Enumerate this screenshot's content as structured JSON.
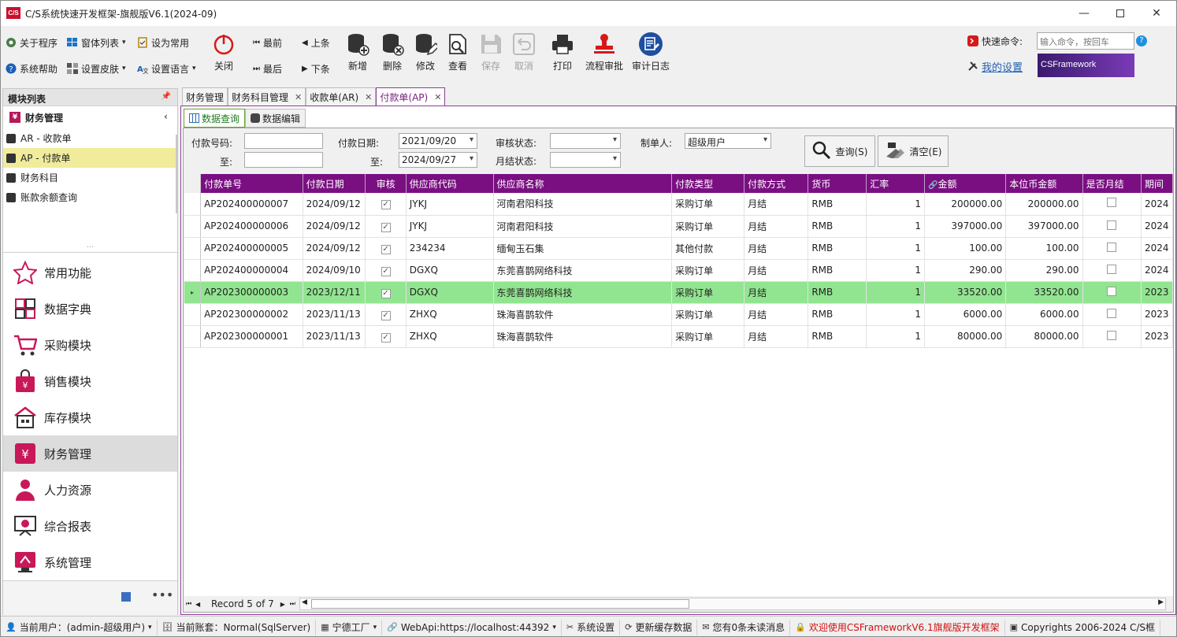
{
  "app": {
    "title": "C/S系统快速开发框架-旗舰版V6.1(2024-09)",
    "logo": "C/S"
  },
  "ribbon": {
    "left_small": [
      {
        "label": "关于程序",
        "icon": "gear-icon"
      },
      {
        "label": "窗体列表",
        "icon": "windows-icon",
        "dropdown": true
      },
      {
        "label": "设为常用",
        "icon": "clipboard-icon"
      },
      {
        "label": "系统帮助",
        "icon": "help-icon"
      },
      {
        "label": "设置皮肤",
        "icon": "skin-icon",
        "dropdown": true
      },
      {
        "label": "设置语言",
        "icon": "language-icon",
        "dropdown": true
      }
    ],
    "close_label": "关闭",
    "nav": {
      "first": "最前",
      "prev": "上条",
      "last": "最后",
      "next": "下条"
    },
    "actions": [
      {
        "label": "新增",
        "icon": "add-db-icon",
        "disabled": false
      },
      {
        "label": "删除",
        "icon": "delete-db-icon",
        "disabled": false
      },
      {
        "label": "修改",
        "icon": "edit-db-icon",
        "disabled": false
      },
      {
        "label": "查看",
        "icon": "view-doc-icon",
        "disabled": false
      },
      {
        "label": "保存",
        "icon": "save-icon",
        "disabled": true
      },
      {
        "label": "取消",
        "icon": "undo-icon",
        "disabled": true
      },
      {
        "label": "打印",
        "icon": "printer-icon",
        "disabled": false
      },
      {
        "label": "流程审批",
        "icon": "stamp-icon",
        "disabled": false
      },
      {
        "label": "审计日志",
        "icon": "audit-log-icon",
        "disabled": false
      }
    ],
    "quick_cmd_label": "快速命令:",
    "quick_cmd_placeholder": "输入命令，按回车",
    "my_settings": "我的设置",
    "brand": "CSFramework"
  },
  "left_panel": {
    "header": "模块列表",
    "group": "财务管理",
    "items": [
      {
        "label": "AR - 收款单",
        "selected": false
      },
      {
        "label": "AP - 付款单",
        "selected": true
      },
      {
        "label": "财务科目",
        "selected": false
      },
      {
        "label": "账款余额查询",
        "selected": false
      }
    ],
    "nav": [
      {
        "label": "常用功能",
        "icon": "star-icon",
        "active": false
      },
      {
        "label": "数据字典",
        "icon": "dictionary-icon",
        "active": false
      },
      {
        "label": "采购模块",
        "icon": "cart-icon",
        "active": false
      },
      {
        "label": "销售模块",
        "icon": "shopping-bag-icon",
        "active": false
      },
      {
        "label": "库存模块",
        "icon": "warehouse-icon",
        "active": false
      },
      {
        "label": "财务管理",
        "icon": "finance-icon",
        "active": true
      },
      {
        "label": "人力资源",
        "icon": "person-icon",
        "active": false
      },
      {
        "label": "综合报表",
        "icon": "report-icon",
        "active": false
      },
      {
        "label": "系统管理",
        "icon": "system-icon",
        "active": false
      }
    ]
  },
  "tabs": [
    {
      "label": "财务管理",
      "closable": false,
      "active": false
    },
    {
      "label": "财务科目管理",
      "closable": true,
      "active": false
    },
    {
      "label": "收款单(AR)",
      "closable": true,
      "active": false
    },
    {
      "label": "付款单(AP)",
      "closable": true,
      "active": true
    }
  ],
  "subtabs": [
    {
      "label": "数据查询",
      "active": true
    },
    {
      "label": "数据编辑",
      "active": false
    }
  ],
  "filters": {
    "pay_no_label": "付款号码:",
    "to_label": "至:",
    "pay_date_label": "付款日期:",
    "date_from": "2021/09/20",
    "date_to": "2024/09/27",
    "audit_label": "审核状态:",
    "monthly_label": "月结状态:",
    "maker_label": "制单人:",
    "maker_value": "超级用户",
    "query_btn": "查询(S)",
    "clear_btn": "清空(E)"
  },
  "grid": {
    "columns": [
      "付款单号",
      "付款日期",
      "审核",
      "供应商代码",
      "供应商名称",
      "付款类型",
      "付款方式",
      "货币",
      "汇率",
      "金额",
      "本位币金额",
      "是否月结",
      "期间"
    ],
    "rows": [
      {
        "no": "AP202400000007",
        "date": "2024/09/12",
        "audit": true,
        "code": "JYKJ",
        "name": "河南君阳科技",
        "type": "采购订单",
        "method": "月结",
        "cur": "RMB",
        "rate": "1",
        "amount": "200000.00",
        "base": "200000.00",
        "monthly": false,
        "period": "2024",
        "sel": false
      },
      {
        "no": "AP202400000006",
        "date": "2024/09/12",
        "audit": true,
        "code": "JYKJ",
        "name": "河南君阳科技",
        "type": "采购订单",
        "method": "月结",
        "cur": "RMB",
        "rate": "1",
        "amount": "397000.00",
        "base": "397000.00",
        "monthly": false,
        "period": "2024",
        "sel": false
      },
      {
        "no": "AP202400000005",
        "date": "2024/09/12",
        "audit": true,
        "code": "234234",
        "name": "缅甸玉石集",
        "type": "其他付款",
        "method": "月结",
        "cur": "RMB",
        "rate": "1",
        "amount": "100.00",
        "base": "100.00",
        "monthly": false,
        "period": "2024",
        "sel": false
      },
      {
        "no": "AP202400000004",
        "date": "2024/09/10",
        "audit": true,
        "code": "DGXQ",
        "name": "东莞喜鹊网络科技",
        "type": "采购订单",
        "method": "月结",
        "cur": "RMB",
        "rate": "1",
        "amount": "290.00",
        "base": "290.00",
        "monthly": false,
        "period": "2024",
        "sel": false
      },
      {
        "no": "AP202300000003",
        "date": "2023/12/11",
        "audit": true,
        "code": "DGXQ",
        "name": "东莞喜鹊网络科技",
        "type": "采购订单",
        "method": "月结",
        "cur": "RMB",
        "rate": "1",
        "amount": "33520.00",
        "base": "33520.00",
        "monthly": false,
        "period": "2023",
        "sel": true
      },
      {
        "no": "AP202300000002",
        "date": "2023/11/13",
        "audit": true,
        "code": "ZHXQ",
        "name": "珠海喜鹊软件",
        "type": "采购订单",
        "method": "月结",
        "cur": "RMB",
        "rate": "1",
        "amount": "6000.00",
        "base": "6000.00",
        "monthly": false,
        "period": "2023",
        "sel": false
      },
      {
        "no": "AP202300000001",
        "date": "2023/11/13",
        "audit": true,
        "code": "ZHXQ",
        "name": "珠海喜鹊软件",
        "type": "采购订单",
        "method": "月结",
        "cur": "RMB",
        "rate": "1",
        "amount": "80000.00",
        "base": "80000.00",
        "monthly": false,
        "period": "2023",
        "sel": false
      }
    ],
    "pager": "Record 5 of 7"
  },
  "status": [
    {
      "label": "当前用户：(admin-超级用户)",
      "icon": "user-icon",
      "dropdown": true
    },
    {
      "label": "当前账套：Normal(SqlServer)",
      "icon": "database-icon",
      "dropdown": false
    },
    {
      "label": "宁德工厂",
      "icon": "factory-icon",
      "dropdown": true
    },
    {
      "label": "WebApi:https://localhost:44392",
      "icon": "link-icon",
      "dropdown": true
    },
    {
      "label": "系统设置",
      "icon": "tools-icon",
      "dropdown": false
    },
    {
      "label": "更新缓存数据",
      "icon": "refresh-icon",
      "dropdown": false
    },
    {
      "label": "您有0条未读消息",
      "icon": "mail-icon",
      "dropdown": false
    },
    {
      "label": "欢迎使用CSFrameworkV6.1旗舰版开发框架",
      "icon": "lock-icon",
      "dropdown": false,
      "color": "#d01010"
    },
    {
      "label": "Copyrights 2006-2024 C/S框",
      "icon": "cube-icon",
      "dropdown": false
    }
  ]
}
